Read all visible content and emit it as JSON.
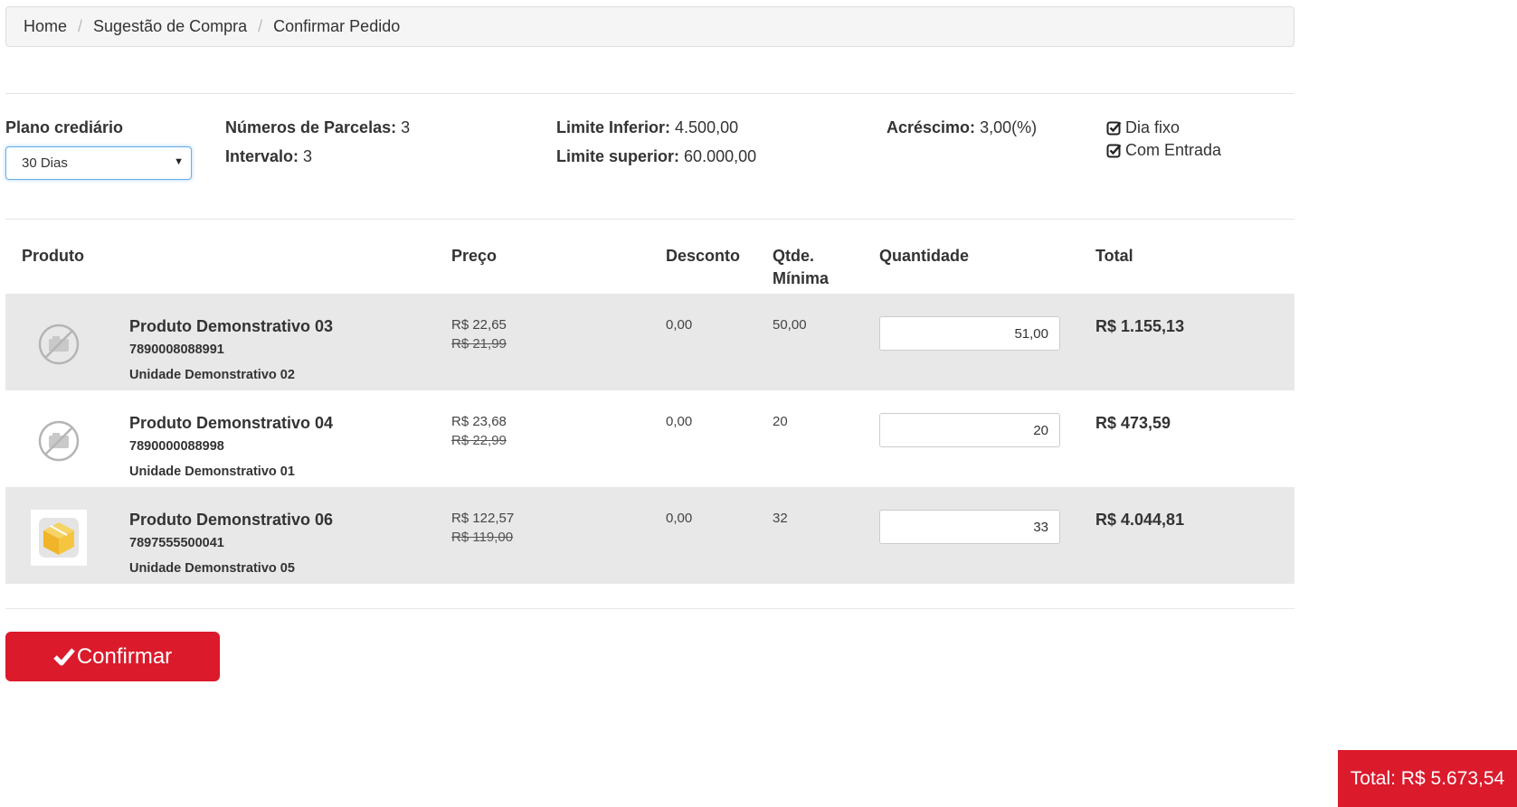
{
  "breadcrumb": {
    "items": [
      "Home",
      "Sugestão de Compra",
      "Confirmar Pedido"
    ],
    "separator": "/"
  },
  "plan": {
    "label": "Plano crediário",
    "selected": "30 Dias",
    "parcelas_label": "Números de Parcelas:",
    "parcelas_value": "3",
    "intervalo_label": "Intervalo:",
    "intervalo_value": "3",
    "limite_inferior_label": "Limite Inferior:",
    "limite_inferior_value": "4.500,00",
    "limite_superior_label": "Limite superior:",
    "limite_superior_value": "60.000,00",
    "acrescimo_label": "Acréscimo:",
    "acrescimo_value": "3,00(%)",
    "options": [
      {
        "label": "Dia fixo",
        "checked": true
      },
      {
        "label": "Com Entrada",
        "checked": true
      }
    ]
  },
  "table": {
    "headers": {
      "produto": "Produto",
      "preco": "Preço",
      "desconto": "Desconto",
      "qtde_minima_1": "Qtde.",
      "qtde_minima_2": "Mínima",
      "quantidade": "Quantidade",
      "total": "Total"
    },
    "rows": [
      {
        "image": "no-image-icon",
        "name": "Produto Demonstrativo 03",
        "code": "7890008088991",
        "unit": "Unidade Demonstrativo 02",
        "price": "R$ 22,65",
        "old_price": "R$ 21,99",
        "discount": "0,00",
        "min_qty": "50,00",
        "quantity": "51,00",
        "total": "R$ 1.155,13"
      },
      {
        "image": "no-image-icon",
        "name": "Produto Demonstrativo 04",
        "code": "7890000088998",
        "unit": "Unidade Demonstrativo 01",
        "price": "R$ 23,68",
        "old_price": "R$ 22,99",
        "discount": "0,00",
        "min_qty": "20",
        "quantity": "20",
        "total": "R$ 473,59"
      },
      {
        "image": "product-box-icon",
        "name": "Produto Demonstrativo 06",
        "code": "7897555500041",
        "unit": "Unidade Demonstrativo 05",
        "price": "R$ 122,57",
        "old_price": "R$ 119,00",
        "discount": "0,00",
        "min_qty": "32",
        "quantity": "33",
        "total": "R$ 4.044,81"
      }
    ]
  },
  "actions": {
    "confirm_label": "Confirmar",
    "confirm_icon": "check-icon"
  },
  "summary": {
    "total_text": "Total: R$ 5.673,54"
  },
  "colors": {
    "accent": "#db1a2c",
    "row_alt": "#e8e8e8",
    "breadcrumb_bg": "#f5f5f5"
  }
}
